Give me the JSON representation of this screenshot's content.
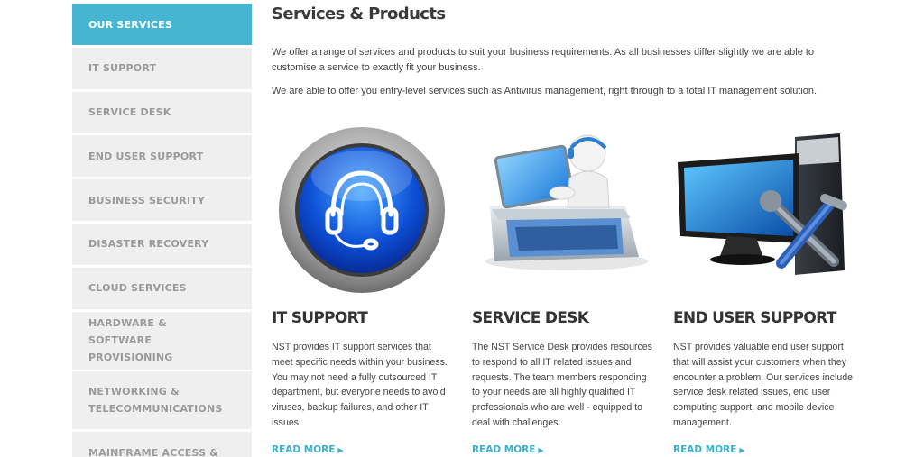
{
  "sidebar": {
    "items": [
      {
        "label": "OUR SERVICES"
      },
      {
        "label": "IT SUPPORT"
      },
      {
        "label": "SERVICE DESK"
      },
      {
        "label": "END USER SUPPORT"
      },
      {
        "label": "BUSINESS SECURITY"
      },
      {
        "label": "DISASTER RECOVERY"
      },
      {
        "label": "CLOUD SERVICES"
      },
      {
        "label": "HARDWARE & SOFTWARE PROVISIONING"
      },
      {
        "label": "NETWORKING & TELECOMMUNICATIONS"
      },
      {
        "label": "MAINFRAME ACCESS &"
      }
    ]
  },
  "main": {
    "title": "Services & Products",
    "intro": [
      "We offer a range of services and products to suit your business requirements. As all businesses differ slightly we are able to customise a service to exactly fit your business.",
      "We are able to offer you entry-level services such as Antivirus management, right through to a total IT management solution."
    ],
    "cards": [
      {
        "title": "IT SUPPORT",
        "text": "NST provides IT support services that meet specific needs within your business. You may not need a fully outsourced IT department, but everyone needs to avoid viruses, backup failures, and other IT issues.",
        "link": "READ MORE",
        "icon": "headset-icon"
      },
      {
        "title": "SERVICE DESK",
        "text": "The NST Service Desk provides resources to respond to all IT related issues and requests. The team members responding to your needs are all highly qualified IT professionals who are well - equipped to deal with challenges.",
        "link": "READ MORE",
        "icon": "helpdesk-agent-icon"
      },
      {
        "title": "END USER SUPPORT",
        "text": "NST provides valuable end user support that will assist your customers when they encounter a problem. Our services include service desk related issues, end user computing support, and mobile device management.",
        "link": "READ MORE",
        "icon": "computer-tools-icon"
      }
    ]
  },
  "colors": {
    "accent": "#46b5d1",
    "link": "#3ab0cd",
    "sidebar_bg": "#efefef",
    "sidebar_text": "#9a9a9a"
  }
}
